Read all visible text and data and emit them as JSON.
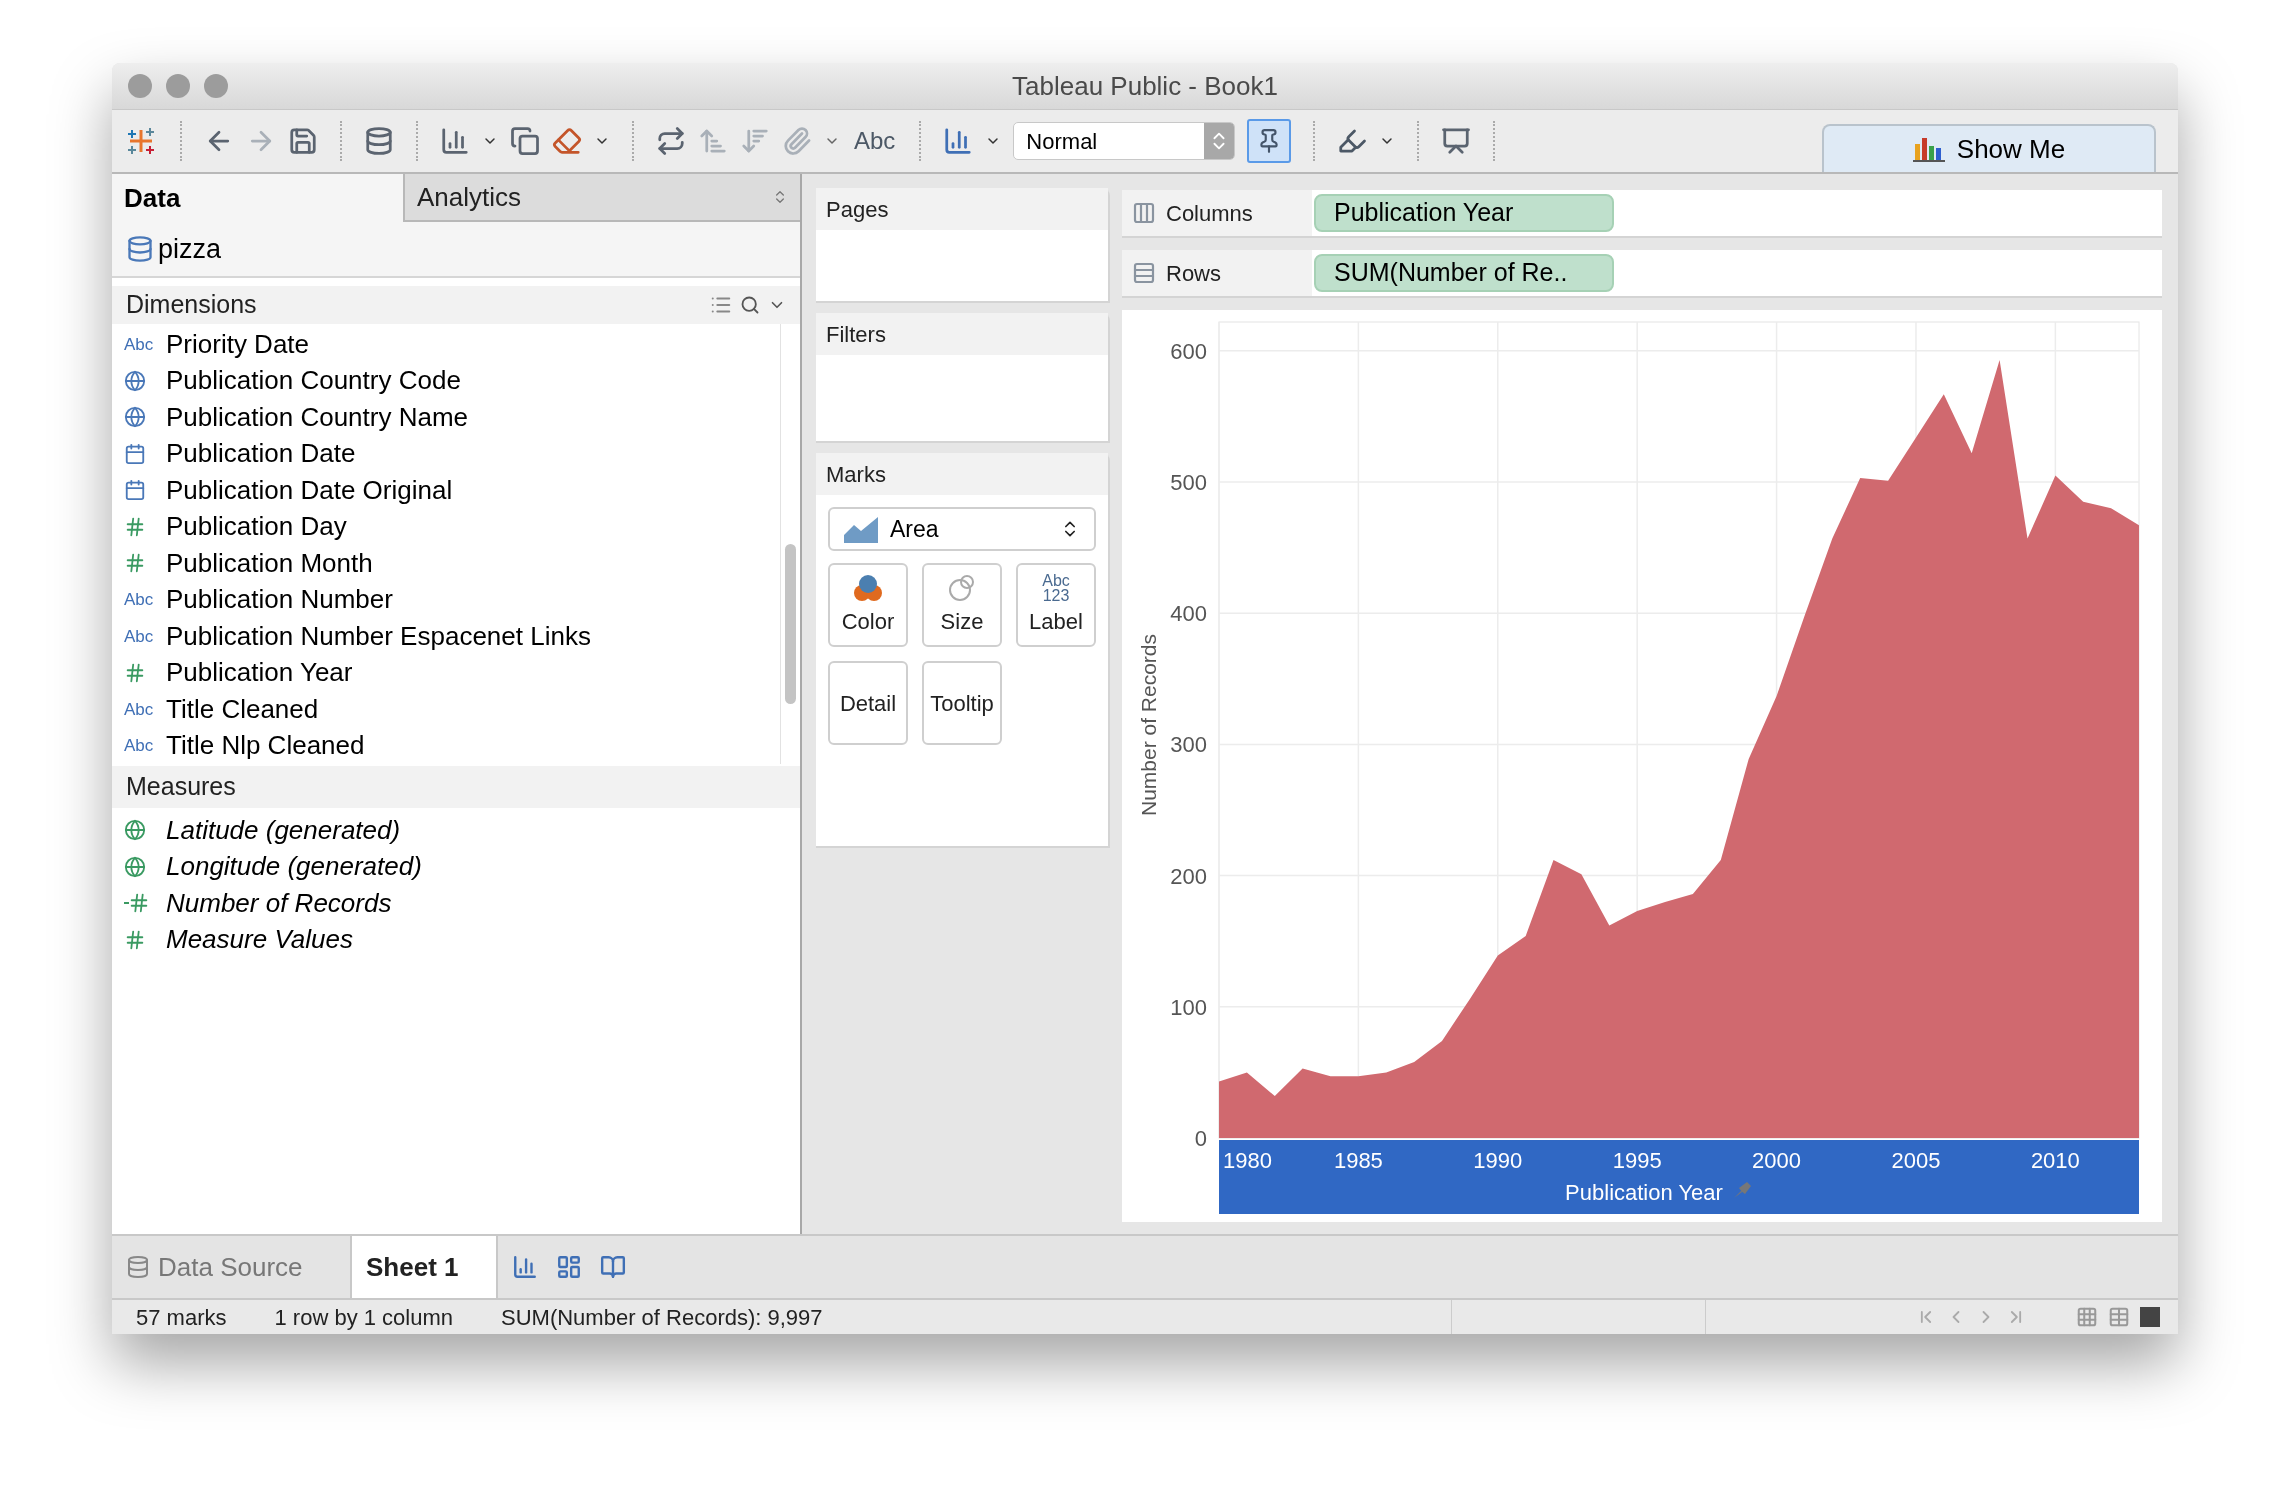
{
  "window": {
    "title": "Tableau Public - Book1"
  },
  "toolbar": {
    "text_button": "Abc",
    "view_size": "Normal",
    "pin_selected": true,
    "show_me": "Show Me"
  },
  "left_panel": {
    "tabs": [
      {
        "label": "Data",
        "selected": true
      },
      {
        "label": "Analytics",
        "selected": false
      }
    ],
    "data_source": "pizza",
    "dimensions": {
      "title": "Dimensions",
      "items": [
        {
          "kind": "string",
          "icon_text": "Abc",
          "label": "Priority Date"
        },
        {
          "kind": "geo",
          "label": "Publication Country Code"
        },
        {
          "kind": "geo",
          "label": "Publication Country Name"
        },
        {
          "kind": "date",
          "label": "Publication Date"
        },
        {
          "kind": "date",
          "label": "Publication Date Original"
        },
        {
          "kind": "number",
          "label": "Publication Day"
        },
        {
          "kind": "number",
          "label": "Publication Month"
        },
        {
          "kind": "string",
          "icon_text": "Abc",
          "label": "Publication Number"
        },
        {
          "kind": "string",
          "icon_text": "Abc",
          "label": "Publication Number Espacenet Links"
        },
        {
          "kind": "number",
          "label": "Publication Year"
        },
        {
          "kind": "string",
          "icon_text": "Abc",
          "label": "Title Cleaned"
        },
        {
          "kind": "string",
          "icon_text": "Abc",
          "label": "Title Nlp Cleaned"
        }
      ]
    },
    "measures": {
      "title": "Measures",
      "items": [
        {
          "kind": "geo",
          "label": "Latitude (generated)"
        },
        {
          "kind": "geo",
          "label": "Longitude (generated)"
        },
        {
          "kind": "count",
          "label": "Number of Records"
        },
        {
          "kind": "number",
          "label": "Measure Values"
        }
      ]
    }
  },
  "cards": {
    "pages": "Pages",
    "filters": "Filters",
    "marks": {
      "title": "Marks",
      "type": "Area",
      "buttons": [
        {
          "kind": "color",
          "label": "Color"
        },
        {
          "kind": "size",
          "label": "Size"
        },
        {
          "kind": "label",
          "label": "Label",
          "icon_lines": [
            "Abc",
            "123"
          ]
        },
        {
          "kind": "detail",
          "label": "Detail"
        },
        {
          "kind": "tooltip",
          "label": "Tooltip"
        }
      ]
    }
  },
  "shelves": [
    {
      "kind": "columns",
      "label": "Columns",
      "pill": "Publication Year"
    },
    {
      "kind": "rows",
      "label": "Rows",
      "pill": "SUM(Number of Re.."
    }
  ],
  "chart": {
    "chart_data": {
      "type": "area",
      "xlabel": "Publication Year",
      "ylabel": "Number of Records",
      "x": [
        1980,
        1981,
        1982,
        1983,
        1984,
        1985,
        1986,
        1987,
        1988,
        1989,
        1990,
        1991,
        1992,
        1993,
        1994,
        1995,
        1996,
        1997,
        1998,
        1999,
        2000,
        2001,
        2002,
        2003,
        2004,
        2005,
        2006,
        2007,
        2008,
        2009,
        2010,
        2011,
        2012,
        2013
      ],
      "grid": true,
      "series": [
        {
          "color": "#d0696f",
          "values": [
            43,
            50,
            32,
            53,
            47,
            47,
            50,
            58,
            74,
            106,
            139,
            154,
            212,
            201,
            162,
            173,
            180,
            186,
            212,
            289,
            337,
            398,
            457,
            503,
            501,
            534,
            567,
            522,
            593,
            457,
            505,
            485,
            480,
            467
          ]
        }
      ],
      "xlim": [
        1980,
        2013
      ],
      "ylim": [
        0,
        622
      ],
      "xticks": [
        1980,
        1985,
        1990,
        1995,
        2000,
        2005,
        2010
      ],
      "yticks": [
        0,
        100,
        200,
        300,
        400,
        500,
        600
      ]
    }
  },
  "sheet_tabs": [
    {
      "kind": "data_source",
      "label": "Data Source",
      "selected": false
    },
    {
      "kind": "sheet",
      "label": "Sheet 1",
      "selected": true
    }
  ],
  "status_bar": [
    "57 marks",
    "1 row by 1 column",
    "SUM(Number of Records): 9,997"
  ]
}
